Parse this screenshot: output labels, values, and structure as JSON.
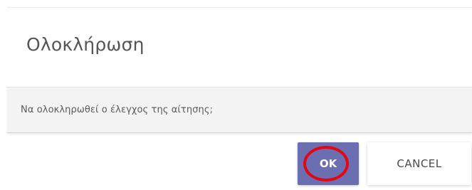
{
  "dialog": {
    "title": "Ολοκλήρωση",
    "message": "Να ολοκληρωθεί ο έλεγχος της αίτησης;"
  },
  "actions": {
    "ok_label": "OK",
    "cancel_label": "CANCEL"
  },
  "colors": {
    "primary_button": "#6b6fb2",
    "highlight_ring": "#e30613",
    "content_band": "#f3f3f3"
  }
}
